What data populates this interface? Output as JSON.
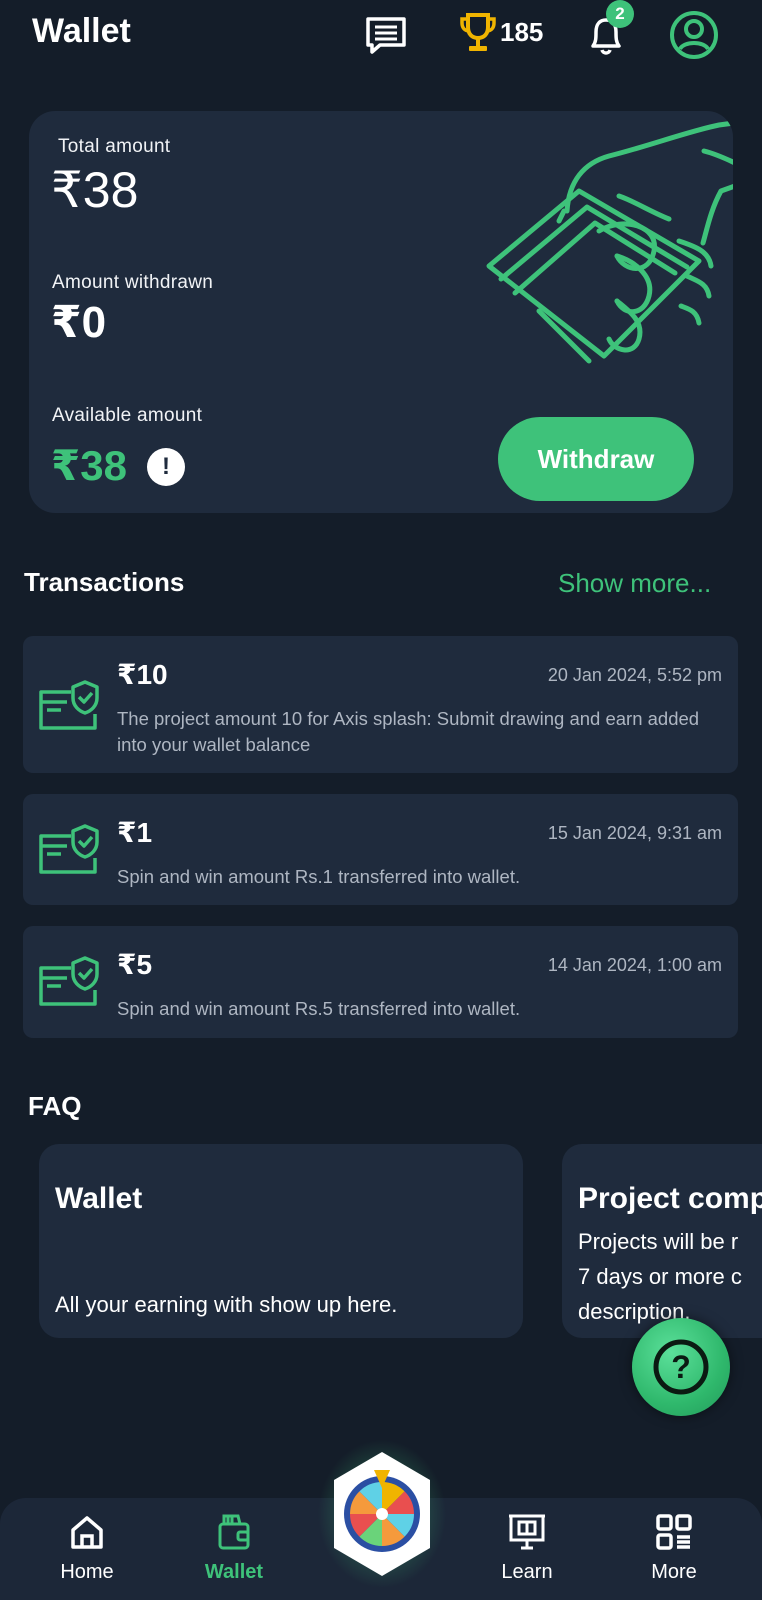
{
  "header": {
    "title": "Wallet",
    "trophy_count": "185",
    "notification_count": "2"
  },
  "summary": {
    "total_label": "Total amount",
    "total_value": "₹38",
    "withdrawn_label": "Amount withdrawn",
    "withdrawn_value": "₹0",
    "available_label": "Available amount",
    "available_value": "₹38",
    "info_glyph": "!",
    "withdraw_label": "Withdraw"
  },
  "transactions": {
    "title": "Transactions",
    "show_more": "Show more...",
    "items": [
      {
        "amount": "₹10",
        "date": "20 Jan 2024, 5:52 pm",
        "description": "The project amount 10 for Axis splash: Submit drawing and earn added into your wallet balance"
      },
      {
        "amount": "₹1",
        "date": "15 Jan 2024, 9:31 am",
        "description": "Spin and win amount Rs.1 transferred into wallet."
      },
      {
        "amount": "₹5",
        "date": "14 Jan 2024, 1:00 am",
        "description": "Spin and win amount Rs.5 transferred into wallet."
      }
    ]
  },
  "faq": {
    "title": "FAQ",
    "cards": [
      {
        "title": "Wallet",
        "lines": [
          "All your earning with show up here."
        ]
      },
      {
        "title": "Project comp",
        "lines": [
          "Projects will be r",
          "7 days or more c",
          "description."
        ]
      }
    ]
  },
  "help_glyph": "?",
  "nav": {
    "items": [
      {
        "label": "Home",
        "icon": "home-icon"
      },
      {
        "label": "Wallet",
        "icon": "wallet-icon"
      },
      {
        "label": "Learn",
        "icon": "learn-icon"
      },
      {
        "label": "More",
        "icon": "grid-icon"
      }
    ],
    "center_icon": "spin-wheel-icon"
  },
  "colors": {
    "background": "#141d29",
    "card": "#1f2b3d",
    "accent": "#3ec27a",
    "trophy": "#f0b400",
    "muted_text": "#aeb6c2"
  }
}
